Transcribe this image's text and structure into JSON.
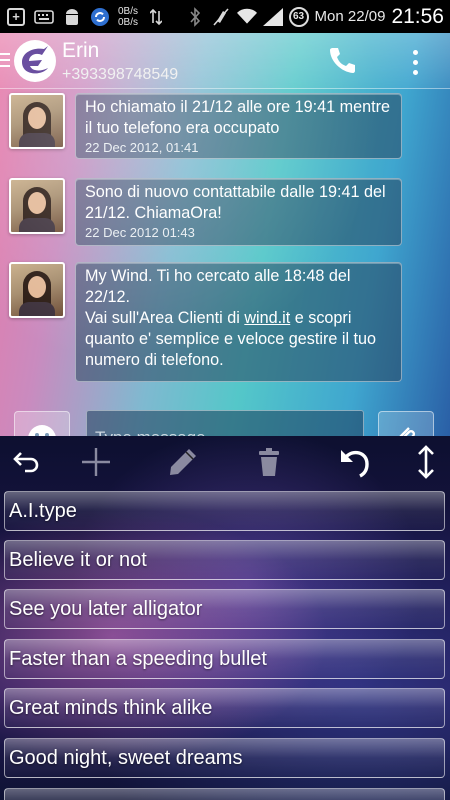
{
  "status_bar": {
    "speed_up": "0B/s",
    "speed_down": "0B/s",
    "battery": "63",
    "date": "Mon 22/09",
    "time": "21:56"
  },
  "header": {
    "contact_name": "Erin",
    "contact_number": "+393398748549"
  },
  "messages": [
    {
      "text": "Ho chiamato il 21/12 alle ore 19:41 mentre il tuo telefono era occupato",
      "timestamp": "22 Dec 2012, 01:41"
    },
    {
      "text": "Sono di nuovo contattabile dalle 19:41 del 21/12. ChiamaOra!",
      "timestamp": "22 Dec 2012 01:43"
    },
    {
      "text_before_link": "My Wind. Ti ho cercato alle 18:48 del 22/12.\nVai sull'Area Clienti di ",
      "link": "wind.it",
      "text_after_link": " e scopri quanto e' semplice e veloce gestire il tuo numero di telefono."
    }
  ],
  "composer": {
    "placeholder": "Type message"
  },
  "quick_replies": [
    "A.I.type",
    "Believe it or not",
    "See you later alligator",
    "Faster than a speeding bullet",
    "Great minds think alike",
    "Good night, sweet dreams"
  ],
  "icons": {
    "toolbar": [
      "back-icon",
      "add-icon",
      "edit-icon",
      "trash-icon",
      "undo-icon",
      "resize-icon"
    ]
  }
}
